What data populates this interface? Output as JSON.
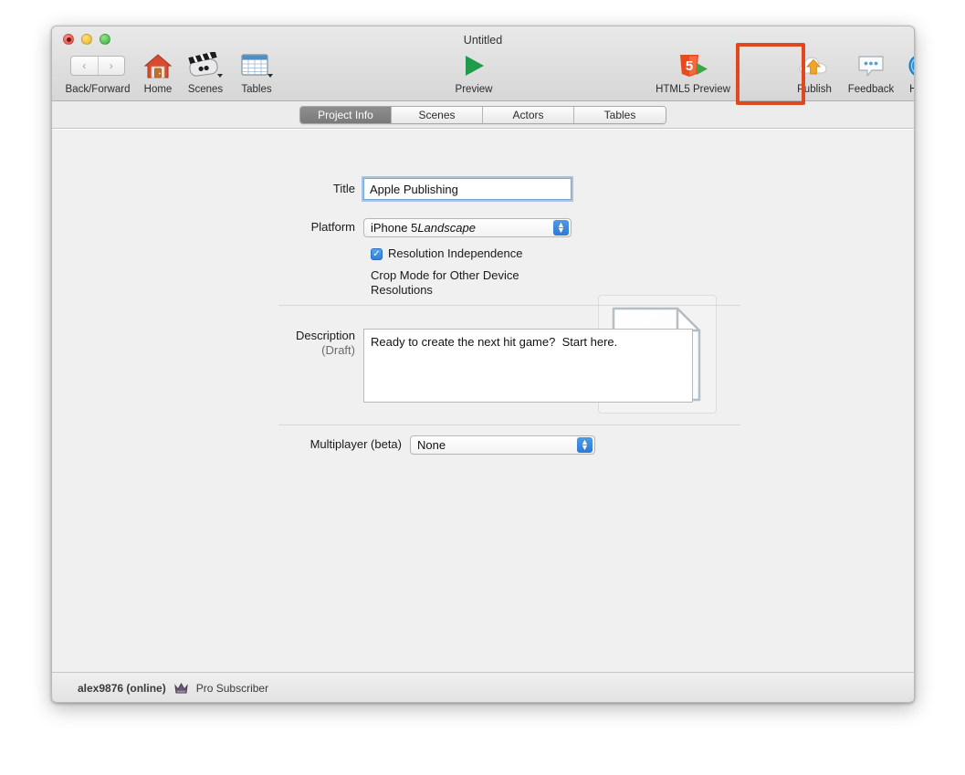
{
  "window": {
    "title": "Untitled",
    "traffic_lights": [
      "close-red",
      "minimize-yellow",
      "zoom-green"
    ]
  },
  "toolbar": {
    "items": [
      {
        "name": "back-forward",
        "label": "Back/Forward",
        "icon": "chevron-left-right-icon"
      },
      {
        "name": "home",
        "label": "Home",
        "icon": "home-icon"
      },
      {
        "name": "scenes",
        "label": "Scenes",
        "icon": "clapperboard-icon"
      },
      {
        "name": "tables",
        "label": "Tables",
        "icon": "table-grid-icon"
      },
      {
        "name": "preview",
        "label": "Preview",
        "icon": "play-triangle-icon"
      },
      {
        "name": "html5-preview",
        "label": "HTML5 Preview",
        "icon": "html5-icon"
      },
      {
        "name": "publish",
        "label": "Publish",
        "icon": "cloud-upload-icon"
      },
      {
        "name": "feedback",
        "label": "Feedback",
        "icon": "speech-bubble-icon"
      },
      {
        "name": "help",
        "label": "Help",
        "icon": "question-circle-icon"
      }
    ],
    "highlight": {
      "target": "publish",
      "color": "#e0491f"
    }
  },
  "tabs": [
    {
      "label": "Project Info",
      "active": true
    },
    {
      "label": "Scenes",
      "active": false
    },
    {
      "label": "Actors",
      "active": false
    },
    {
      "label": "Tables",
      "active": false
    }
  ],
  "form": {
    "title": {
      "label": "Title",
      "value": "Apple Publishing",
      "placeholder": "",
      "focused": true
    },
    "platform": {
      "label": "Platform",
      "value_plain": "iPhone 5 ",
      "value_italic": "Landscape",
      "selected": "iPhone 5 Landscape"
    },
    "resolution_independence": {
      "label": "Resolution Independence",
      "checked": true,
      "check_glyph": "✓"
    },
    "crop_mode_note": "Crop Mode for Other Device Resolutions",
    "description": {
      "label": "Description",
      "sublabel": "(Draft)",
      "value": "Ready to create the next hit game?  Start here.",
      "placeholder": ""
    },
    "multiplayer": {
      "label": "Multiplayer (beta)",
      "selected": "None"
    }
  },
  "thumbnail": {
    "name": "document-page-icon"
  },
  "statusbar": {
    "user": "alex9876 (online)",
    "badge_icon": "crown-icon",
    "tier": "Pro Subscriber"
  },
  "colors": {
    "accent_blue": "#2e7fd8",
    "highlight_orange": "#e0491f",
    "window_chrome": "#ececec",
    "content_bg": "#f0f0f0"
  }
}
